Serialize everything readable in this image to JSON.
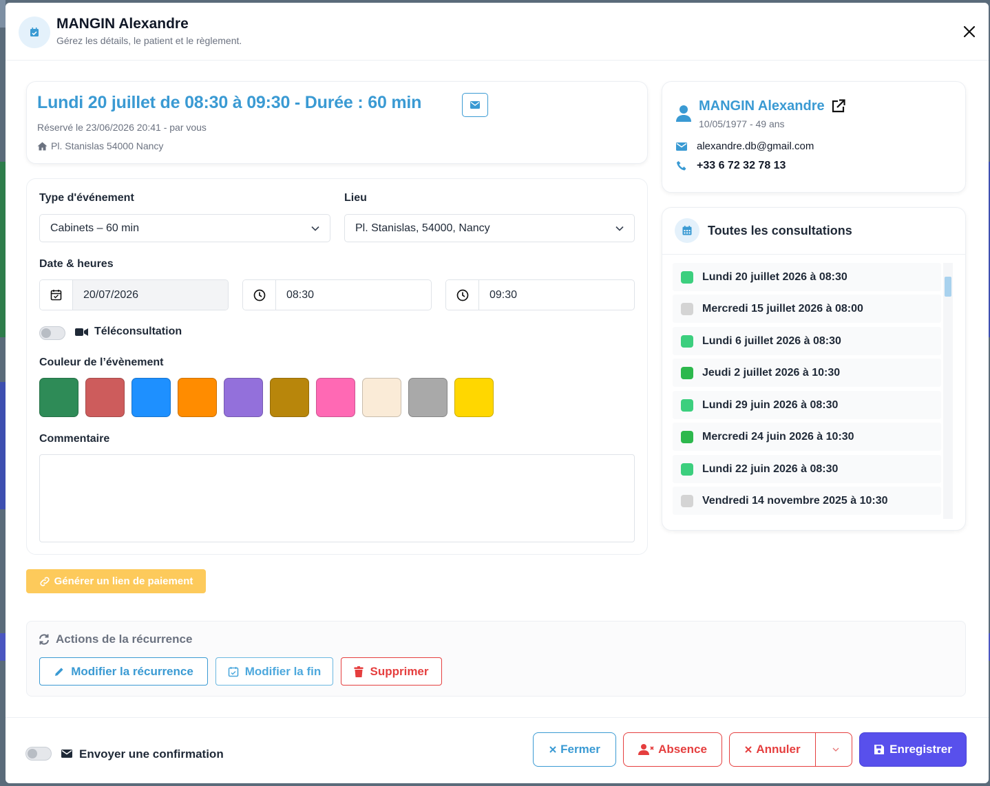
{
  "header": {
    "title": "MANGIN Alexandre",
    "subtitle": "Gérez les détails, le patient et le règlement."
  },
  "appointment": {
    "title": "Lundi 20 juillet de 08:30 à 09:30 - Durée : 60 min",
    "booked": "Réservé le 23/06/2026 20:41 - par vous",
    "address": "Pl. Stanislas 54000 Nancy"
  },
  "form": {
    "event_type_label": "Type d'événement",
    "event_type_value": "Cabinets – 60 min",
    "location_label": "Lieu",
    "location_value": "Pl. Stanislas, 54000, Nancy",
    "date_label": "Date & heures",
    "date_value": "20/07/2026",
    "start_time": "08:30",
    "end_time": "09:30",
    "teleconsultation_label": "Téléconsultation",
    "teleconsultation_on": false,
    "color_label": "Couleur de l’évènement",
    "colors": [
      "#2e8b57",
      "#cd5c5c",
      "#1e90ff",
      "#ff8c00",
      "#9370db",
      "#b8860b",
      "#ff69b4",
      "#faebd7",
      "#a9a9a9",
      "#ffd700"
    ],
    "comment_label": "Commentaire",
    "comment_value": ""
  },
  "payment_button": "Générer un lien de paiement",
  "recurrence": {
    "title": "Actions de la récurrence",
    "edit": "Modifier la récurrence",
    "edit_end": "Modifier la fin",
    "delete": "Supprimer"
  },
  "patient": {
    "name": "MANGIN Alexandre",
    "dob": "10/05/1977 - 49 ans",
    "email": "alexandre.db@gmail.com",
    "phone": "+33 6 72 32 78 13"
  },
  "consultations": {
    "title": "Toutes les consultations",
    "items": [
      {
        "label": "Lundi 20 juillet 2026 à 08:30",
        "color": "#3ccf7e"
      },
      {
        "label": "Mercredi 15 juillet 2026 à 08:00",
        "color": "#d4d4d4"
      },
      {
        "label": "Lundi 6 juillet 2026 à 08:30",
        "color": "#3ccf7e"
      },
      {
        "label": "Jeudi 2 juillet 2026 à 10:30",
        "color": "#2db84d"
      },
      {
        "label": "Lundi 29 juin 2026 à 08:30",
        "color": "#3ccf7e"
      },
      {
        "label": "Mercredi 24 juin 2026 à 10:30",
        "color": "#2db84d"
      },
      {
        "label": "Lundi 22 juin 2026 à 08:30",
        "color": "#3ccf7e"
      },
      {
        "label": "Vendredi 14 novembre 2025 à 10:30",
        "color": "#d4d4d4"
      }
    ]
  },
  "footer": {
    "confirmation_label": "Envoyer une confirmation",
    "confirmation_on": false,
    "close": "Fermer",
    "absence": "Absence",
    "cancel": "Annuler",
    "save": "Enregistrer"
  },
  "theme": {
    "accent": "#3a9ad3",
    "danger": "#e53e3e",
    "primary": "#5850ec",
    "warning": "#fdca5b"
  }
}
